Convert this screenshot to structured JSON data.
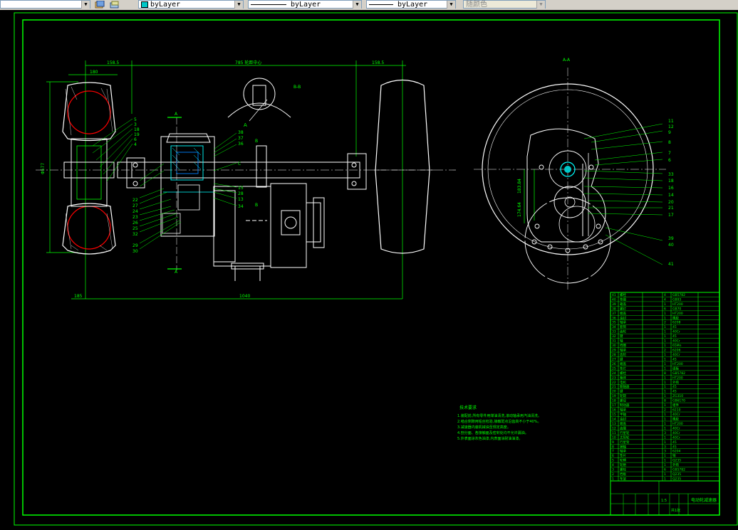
{
  "toolbar": {
    "color_control": "byLayer",
    "linetype_control": "byLayer",
    "lineweight_control": "byLayer",
    "plotstyle_control": "随颜色"
  },
  "drawing": {
    "dims": {
      "top_left": "158.5",
      "top_mid": "785 轮距中心",
      "top_right": "158.5",
      "tire_width": "180",
      "tire_dia": "Φ577",
      "bottom_left": "185",
      "bottom_span": "1040",
      "section_v1": "183.84",
      "section_v2": "174.64"
    },
    "section_labels": {
      "aa_top": "A",
      "aa_bottom": "A",
      "bb": "B-B",
      "bb_mark": "A",
      "aa_view": "A-A",
      "b_top": "B",
      "b_bottom": "B"
    },
    "left_balloons": [
      "5",
      "3",
      "18",
      "19",
      "6",
      "4"
    ],
    "gear_balloons_left": [
      "22",
      "27",
      "24",
      "23",
      "26",
      "25",
      "32",
      "29",
      "30"
    ],
    "top_balloons": [
      "38",
      "37",
      "36"
    ],
    "mid_balloons": [
      "C",
      "15",
      "28",
      "13",
      "34"
    ],
    "right_balloons": [
      "11",
      "12",
      "9",
      "8",
      "7",
      "6",
      "33",
      "18",
      "16",
      "14",
      "20",
      "21",
      "17",
      "39",
      "40",
      "41"
    ],
    "notes": {
      "title": "技术要求",
      "lines": [
        "1.装配前,所有零件用煤油清洗,滚动轴承用汽油清洗。",
        "2.啮合侧隙用铅丝检验,接触斑点沿齿高不小于40%。",
        "3.减速器内装机械油至规定高度。",
        "4.剖分面、各接触面及密封处均不允许漏油。",
        "5.外表面涂灰色油漆,内表面涂耐油油漆。"
      ]
    },
    "title_block": {
      "drawing_name": "电动轮减速器",
      "scale": "1:5",
      "sheet": "共1张"
    }
  },
  "bom_rows": [
    [
      "41",
      "螺栓",
      "4",
      "GB5782"
    ],
    [
      "40",
      "垫圈",
      "4",
      "GB93"
    ],
    [
      "39",
      "箱盖",
      "1",
      "HT200"
    ],
    [
      "38",
      "螺钉",
      "6",
      "GB70"
    ],
    [
      "37",
      "端盖",
      "1",
      "HT200"
    ],
    [
      "36",
      "油封",
      "1",
      "橡胶"
    ],
    [
      "35",
      "轴承",
      "2",
      "6208"
    ],
    [
      "34",
      "套筒",
      "1",
      "45"
    ],
    [
      "33",
      "齿轮",
      "1",
      "40Cr"
    ],
    [
      "32",
      "键",
      "1",
      "45"
    ],
    [
      "31",
      "轴",
      "1",
      "40Cr"
    ],
    [
      "30",
      "挡圈",
      "1",
      "65Mn"
    ],
    [
      "29",
      "轴承",
      "2",
      "6206"
    ],
    [
      "28",
      "齿轮",
      "1",
      "40Cr"
    ],
    [
      "27",
      "键",
      "1",
      "45"
    ],
    [
      "26",
      "端盖",
      "1",
      "HT200"
    ],
    [
      "25",
      "垫片",
      "1",
      "纸板"
    ],
    [
      "24",
      "螺栓",
      "8",
      "GB5782"
    ],
    [
      "23",
      "箱体",
      "1",
      "HT200"
    ],
    [
      "22",
      "电机",
      "1",
      "外购"
    ],
    [
      "21",
      "联轴器",
      "1",
      "45"
    ],
    [
      "20",
      "键",
      "1",
      "45"
    ],
    [
      "19",
      "轮毂",
      "1",
      "ZG310"
    ],
    [
      "18",
      "螺母",
      "8",
      "GB6170"
    ],
    [
      "17",
      "制动器",
      "1",
      "组件"
    ],
    [
      "16",
      "轴承",
      "2",
      "6210"
    ],
    [
      "15",
      "半轴",
      "1",
      "40Cr"
    ],
    [
      "14",
      "油封",
      "1",
      "橡胶"
    ],
    [
      "13",
      "端盖",
      "1",
      "HT200"
    ],
    [
      "12",
      "齿圈",
      "1",
      "40Cr"
    ],
    [
      "11",
      "行星轮",
      "3",
      "40Cr"
    ],
    [
      "10",
      "太阳轮",
      "1",
      "40Cr"
    ],
    [
      "9",
      "行星架",
      "1",
      "45"
    ],
    [
      "8",
      "销轴",
      "3",
      "45"
    ],
    [
      "7",
      "轴承",
      "3",
      "6204"
    ],
    [
      "6",
      "垫片",
      "1",
      "铜"
    ],
    [
      "5",
      "轮辋",
      "1",
      "Q235"
    ],
    [
      "4",
      "轮胎",
      "1",
      "外购"
    ],
    [
      "3",
      "螺栓",
      "6",
      "GB5782"
    ],
    [
      "2",
      "挡板",
      "1",
      "Q235"
    ],
    [
      "1",
      "车架",
      "1",
      "Q235"
    ]
  ]
}
